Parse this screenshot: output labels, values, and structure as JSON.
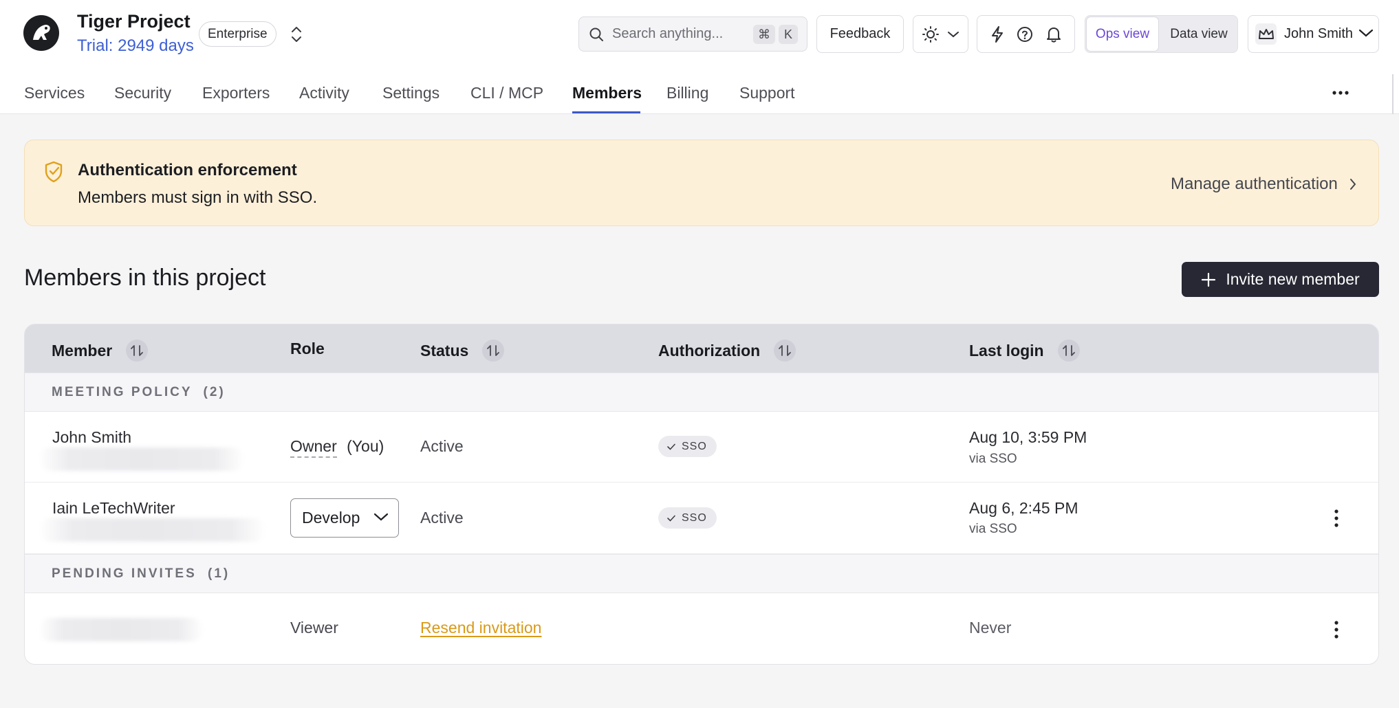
{
  "header": {
    "project_name": "Tiger Project",
    "trial_text": "Trial: 2949 days",
    "plan_badge": "Enterprise",
    "search_placeholder": "Search anything...",
    "search_shortcut_mod": "⌘",
    "search_shortcut_key": "K",
    "feedback_label": "Feedback",
    "view_options": [
      "Ops view",
      "Data view"
    ],
    "active_view": "Ops view",
    "user_name": "John Smith"
  },
  "nav": {
    "items": [
      "Services",
      "Security",
      "Exporters",
      "Activity",
      "Settings",
      "CLI / MCP",
      "Members",
      "Billing",
      "Support"
    ],
    "active": "Members"
  },
  "banner": {
    "title": "Authentication enforcement",
    "text": "Members must sign in with SSO.",
    "link": "Manage authentication"
  },
  "members": {
    "title": "Members in this project",
    "invite_label": "Invite new member",
    "columns": [
      "Member",
      "Role",
      "Status",
      "Authorization",
      "Last login"
    ],
    "groups": [
      {
        "label": "MEETING POLICY",
        "count": "(2)",
        "rows": [
          {
            "name": "John Smith",
            "role": "Owner",
            "role_suffix": "(You)",
            "status": "Active",
            "auth": "SSO",
            "last_login": "Aug 10, 3:59 PM",
            "last_login_via": "via SSO"
          },
          {
            "name": "Iain LeTechWriter",
            "role": "Develop",
            "status": "Active",
            "auth": "SSO",
            "last_login": "Aug 6, 2:45 PM",
            "last_login_via": "via SSO"
          }
        ]
      },
      {
        "label": "PENDING INVITES",
        "count": "(1)",
        "rows": [
          {
            "role": "Viewer",
            "status_link": "Resend invitation",
            "last_login": "Never"
          }
        ]
      }
    ]
  },
  "colors": {
    "accent": "#3c57c7",
    "banner_bg": "#fdf0d9",
    "banner_icon": "#e0a11a",
    "resend_link": "#d99a17",
    "primary_button": "#272833"
  },
  "icons": {
    "logo": "tiger-logo-icon",
    "switcher": "chevron-up-down-icon",
    "search": "search-icon",
    "theme": "sun-icon",
    "bolt": "lightning-icon",
    "help": "help-circle-icon",
    "bell": "bell-icon",
    "avatar": "crown-icon",
    "banner": "shield-check-icon"
  }
}
